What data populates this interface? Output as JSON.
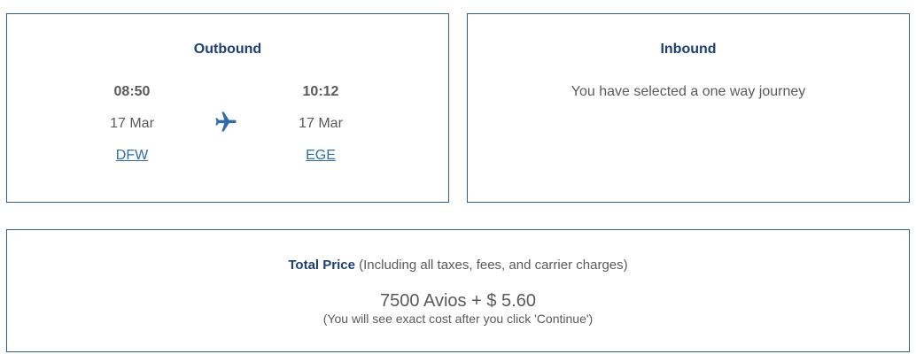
{
  "outbound": {
    "title": "Outbound",
    "departure": {
      "time": "08:50",
      "date": "17 Mar",
      "airport": "DFW"
    },
    "arrival": {
      "time": "10:12",
      "date": "17 Mar",
      "airport": "EGE"
    },
    "icon": "airplane-icon"
  },
  "inbound": {
    "title": "Inbound",
    "message": "You have selected a one way journey"
  },
  "price": {
    "label": "Total Price",
    "qualifier": "(Including all taxes, fees, and carrier charges)",
    "amount": "7500 Avios + $ 5.60",
    "note": "(You will see exact cost after you click 'Continue')"
  },
  "colors": {
    "border": "#2b5f8e",
    "heading": "#1f3f73",
    "link": "#2f6ea9",
    "text": "#5a5a5a",
    "icon": "#2f6ea9"
  }
}
